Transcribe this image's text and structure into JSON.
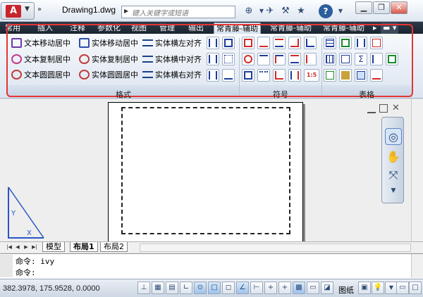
{
  "window": {
    "title": "Drawing1.dwg",
    "search_placeholder": "键入关键字或短语"
  },
  "ribbon": {
    "tabs": [
      {
        "label": "常用"
      },
      {
        "label": "插入"
      },
      {
        "label": "注释"
      },
      {
        "label": "参数化"
      },
      {
        "label": "视图"
      },
      {
        "label": "管理"
      },
      {
        "label": "输出"
      },
      {
        "label": "常青藤-辅助"
      },
      {
        "label": "常青藤-辅助"
      },
      {
        "label": "常青藤-辅助"
      }
    ],
    "format_buttons": [
      {
        "label": "文本移动居中"
      },
      {
        "label": "实体移动居中"
      },
      {
        "label": "实体横左对齐"
      },
      {
        "label": "文本复制居中"
      },
      {
        "label": "实体复制居中"
      },
      {
        "label": "实体横中对齐"
      },
      {
        "label": "文本圆圆居中"
      },
      {
        "label": "实体圆圆居中"
      },
      {
        "label": "实体横右对齐"
      }
    ],
    "panels": {
      "format": "格式",
      "symbol": "符号",
      "table": "表格"
    },
    "symbol_small": {
      "ratio": "1:5"
    }
  },
  "layout": {
    "tabs": [
      {
        "label": "模型"
      },
      {
        "label": "布局1"
      },
      {
        "label": "布局2"
      }
    ]
  },
  "command": {
    "history": "命令: ivy",
    "prompt": "命令:"
  },
  "status": {
    "coords": "382.3978, 175.9528, 0.0000",
    "paper_label": "图纸"
  },
  "colors": {
    "accent": "#e53535",
    "tab_bar": "#1b2430",
    "brand": "#c8242b"
  }
}
